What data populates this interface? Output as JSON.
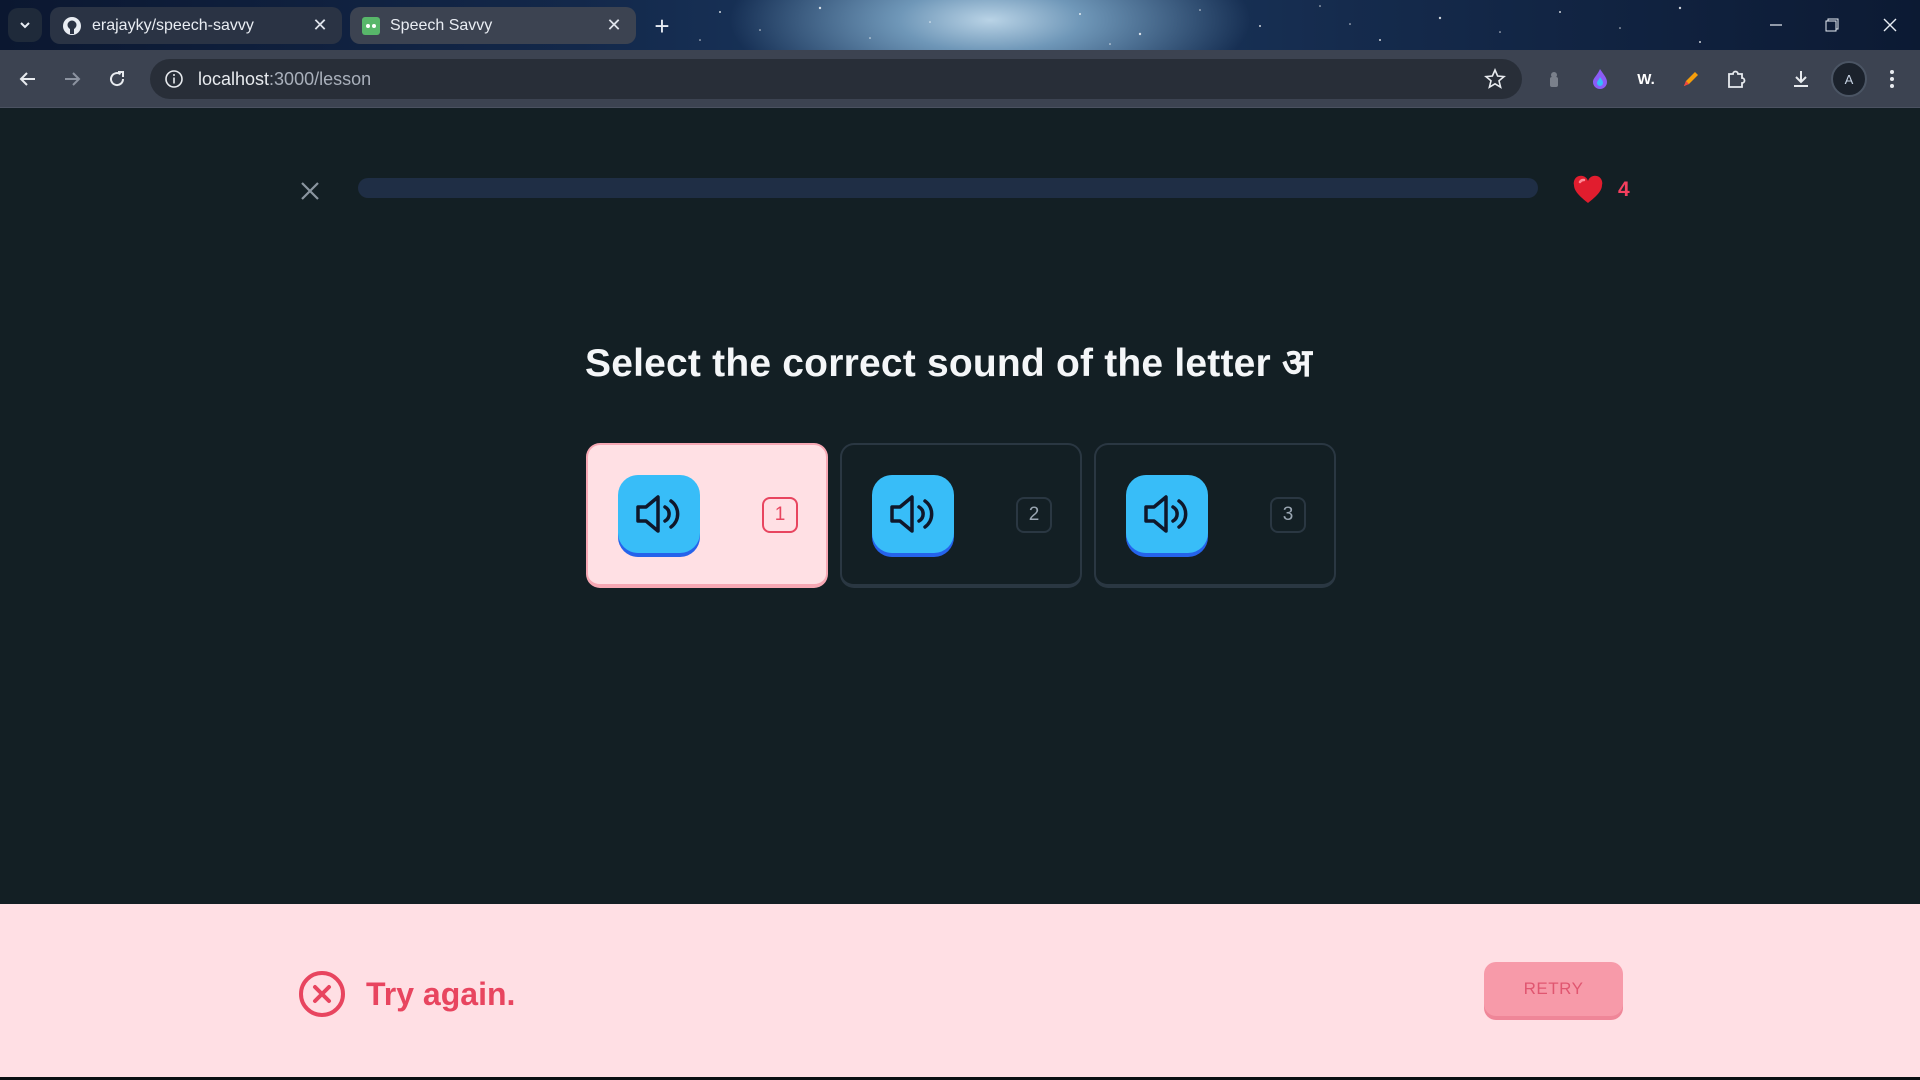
{
  "browser": {
    "tabs": [
      {
        "title": "erajayky/speech-savvy",
        "favicon": "github-icon",
        "active": false
      },
      {
        "title": "Speech Savvy",
        "favicon": "speech-savvy-icon",
        "active": true
      }
    ],
    "address": {
      "host": "localhost",
      "path": ":3000/lesson"
    },
    "profile_initial": "A",
    "ext_w_label": "W."
  },
  "lesson": {
    "progress_percent": 0,
    "hearts": "4",
    "question": "Select the correct sound of the letter अ",
    "choices": [
      {
        "shortcut": "1",
        "selected": true
      },
      {
        "shortcut": "2",
        "selected": false
      },
      {
        "shortcut": "3",
        "selected": false
      }
    ]
  },
  "footer": {
    "status": "Try again.",
    "retry_label": "RETRY"
  },
  "colors": {
    "page_bg": "#131f24",
    "accent_blue": "#38bdf8",
    "error_red": "#e8455f",
    "footer_bg": "#ffdfe4"
  }
}
